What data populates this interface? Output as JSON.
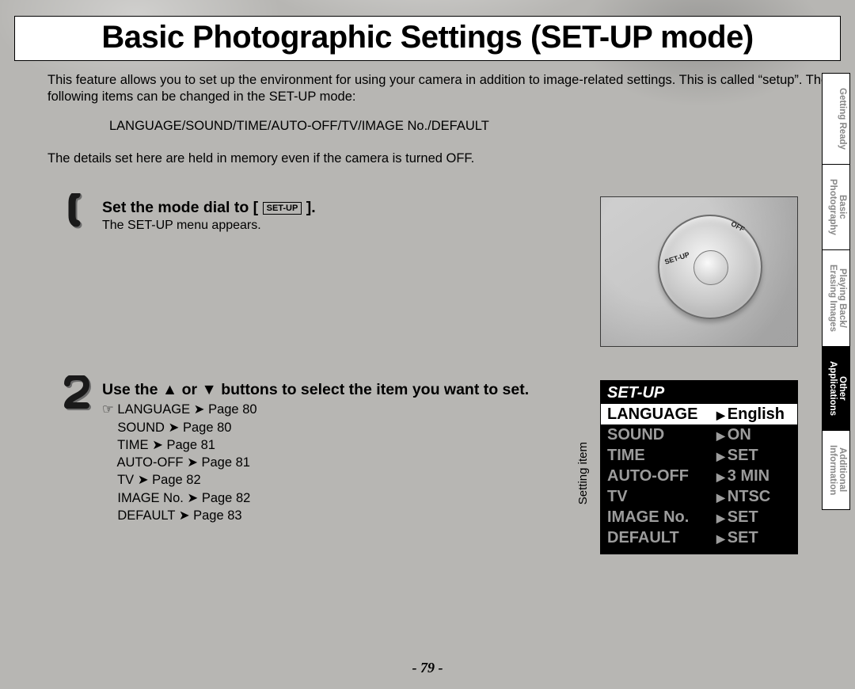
{
  "title": "Basic Photographic Settings (SET-UP mode)",
  "intro": "This feature allows you to set up the environment for using your camera in addition to image-related settings. This is called “setup”. The following items can be changed in the SET-UP mode:",
  "items_line": "LANGUAGE/SOUND/TIME/AUTO-OFF/TV/IMAGE No./DEFAULT",
  "retain_line": "The details set here are held in memory even if the camera is turned OFF.",
  "step1": {
    "head_pre": "Set the mode dial to [ ",
    "chip": "SET-UP",
    "head_post": " ].",
    "sub": "The SET-UP menu appears."
  },
  "step2": {
    "head": "Use the ▲ or ▼ buttons to select the item you want to set.",
    "refs": [
      "LANGUAGE ➤ Page 80",
      "SOUND ➤ Page 80",
      "TIME ➤ Page 81",
      "AUTO-OFF ➤ Page 81",
      "TV ➤ Page 82",
      "IMAGE No. ➤ Page 82",
      "DEFAULT ➤ Page 83"
    ],
    "pointer": "☞"
  },
  "dial": {
    "off": "OFF",
    "setup": "SET-UP"
  },
  "lcd": {
    "title": "SET-UP",
    "rows": [
      {
        "k": "LANGUAGE",
        "v": "English",
        "active": true
      },
      {
        "k": "SOUND",
        "v": "ON"
      },
      {
        "k": "TIME",
        "v": "SET"
      },
      {
        "k": "AUTO-OFF",
        "v": "3 MIN"
      },
      {
        "k": "TV",
        "v": "NTSC"
      },
      {
        "k": "IMAGE No.",
        "v": "SET"
      },
      {
        "k": "DEFAULT",
        "v": "SET"
      }
    ]
  },
  "setting_item_label": "Setting item",
  "tabs": [
    {
      "lines": [
        "Getting Ready"
      ],
      "active": false
    },
    {
      "lines": [
        "Basic",
        "Photography"
      ],
      "active": false
    },
    {
      "lines": [
        "Playing Back/",
        "Erasing Images"
      ],
      "active": false
    },
    {
      "lines": [
        "Other",
        "Applications"
      ],
      "active": true
    },
    {
      "lines": [
        "Additional",
        "Information"
      ],
      "active": false
    }
  ],
  "page_number": "- 79 -"
}
